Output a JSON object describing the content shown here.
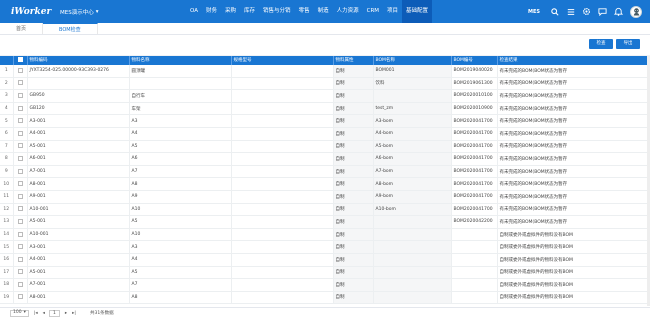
{
  "header": {
    "logo": "iWorker",
    "app_title": "MES演示中心",
    "nav": [
      "OA",
      "财务",
      "采购",
      "库存",
      "销售与分销",
      "零售",
      "制造",
      "人力资源",
      "CRM",
      "项目",
      "基础配置"
    ],
    "active_nav": "基础配置",
    "env_label": "MES"
  },
  "tabs": [
    {
      "label": "首页",
      "active": false
    },
    {
      "label": "BOM检查",
      "active": true
    }
  ],
  "toolbar": {
    "check_label": "检查",
    "export_label": "导出"
  },
  "table": {
    "columns": [
      "物料编码",
      "物料名称",
      "规格型号",
      "物料属性",
      "BOM名称",
      "BOM编号",
      "检查结果"
    ],
    "rows": [
      {
        "idx": "1",
        "code": "JYXT3254-025.00000-93C393-0276",
        "name": "圆顶罐",
        "spec": "",
        "attr": "自制",
        "bom": "BOM001",
        "bomno": "BOM2019040020",
        "result": "有未完成的BOM(BOM状态为暂存"
      },
      {
        "idx": "2",
        "code": "",
        "name": "",
        "spec": "",
        "attr": "自制",
        "bom": "饮料",
        "bomno": "BOM2019061300",
        "result": "有未完成的BOM(BOM状态为暂存"
      },
      {
        "idx": "3",
        "code": "GB950",
        "name": "自行车",
        "spec": "",
        "attr": "自制",
        "bom": "",
        "bomno": "BOM2020010100",
        "result": "有未完成的BOM(BOM状态为暂存"
      },
      {
        "idx": "4",
        "code": "GB120",
        "name": "车架",
        "spec": "",
        "attr": "自制",
        "bom": "test_zm",
        "bomno": "BOM2020010900",
        "result": "有未完成的BOM(BOM状态为暂存"
      },
      {
        "idx": "5",
        "code": "A3-001",
        "name": "A3",
        "spec": "",
        "attr": "自制",
        "bom": "A3-bom",
        "bomno": "BOM2020041700",
        "result": "有未完成的BOM(BOM状态为暂存"
      },
      {
        "idx": "6",
        "code": "A4-001",
        "name": "A4",
        "spec": "",
        "attr": "自制",
        "bom": "A4-bom",
        "bomno": "BOM2020041700",
        "result": "有未完成的BOM(BOM状态为暂存"
      },
      {
        "idx": "7",
        "code": "A5-001",
        "name": "A5",
        "spec": "",
        "attr": "自制",
        "bom": "A5-bom",
        "bomno": "BOM2020041700",
        "result": "有未完成的BOM(BOM状态为暂存"
      },
      {
        "idx": "8",
        "code": "A6-001",
        "name": "A6",
        "spec": "",
        "attr": "自制",
        "bom": "A6-bom",
        "bomno": "BOM2020041700",
        "result": "有未完成的BOM(BOM状态为暂存"
      },
      {
        "idx": "9",
        "code": "A7-001",
        "name": "A7",
        "spec": "",
        "attr": "自制",
        "bom": "A7-bom",
        "bomno": "BOM2020041700",
        "result": "有未完成的BOM(BOM状态为暂存"
      },
      {
        "idx": "10",
        "code": "A8-001",
        "name": "A8",
        "spec": "",
        "attr": "自制",
        "bom": "A8-bom",
        "bomno": "BOM2020041700",
        "result": "有未完成的BOM(BOM状态为暂存"
      },
      {
        "idx": "11",
        "code": "A9-001",
        "name": "A9",
        "spec": "",
        "attr": "自制",
        "bom": "A9-bom",
        "bomno": "BOM2020041700",
        "result": "有未完成的BOM(BOM状态为暂存"
      },
      {
        "idx": "12",
        "code": "A10-001",
        "name": "A10",
        "spec": "",
        "attr": "自制",
        "bom": "A10-bom",
        "bomno": "BOM2020041700",
        "result": "有未完成的BOM(BOM状态为暂存"
      },
      {
        "idx": "13",
        "code": "A5-001",
        "name": "A5",
        "spec": "",
        "attr": "自制",
        "bom": "",
        "bomno": "BOM2020042200",
        "result": "有未完成的BOM(BOM状态为暂存"
      },
      {
        "idx": "14",
        "code": "A10-001",
        "name": "A10",
        "spec": "",
        "attr": "自制",
        "bom": "",
        "bomno": "",
        "result": "自制或委外或虚拟件的物料没有BOM"
      },
      {
        "idx": "15",
        "code": "A3-001",
        "name": "A3",
        "spec": "",
        "attr": "自制",
        "bom": "",
        "bomno": "",
        "result": "自制或委外或虚拟件的物料没有BOM"
      },
      {
        "idx": "16",
        "code": "A4-001",
        "name": "A4",
        "spec": "",
        "attr": "自制",
        "bom": "",
        "bomno": "",
        "result": "自制或委外或虚拟件的物料没有BOM"
      },
      {
        "idx": "17",
        "code": "A5-001",
        "name": "A5",
        "spec": "",
        "attr": "自制",
        "bom": "",
        "bomno": "",
        "result": "自制或委外或虚拟件的物料没有BOM"
      },
      {
        "idx": "18",
        "code": "A7-001",
        "name": "A7",
        "spec": "",
        "attr": "自制",
        "bom": "",
        "bomno": "",
        "result": "自制或委外或虚拟件的物料没有BOM"
      },
      {
        "idx": "19",
        "code": "A8-001",
        "name": "A8",
        "spec": "",
        "attr": "自制",
        "bom": "",
        "bomno": "",
        "result": "自制或委外或虚拟件的物料没有BOM"
      }
    ]
  },
  "pager": {
    "page_size": "100",
    "current_page": "1",
    "total_text": "共31条数据"
  }
}
